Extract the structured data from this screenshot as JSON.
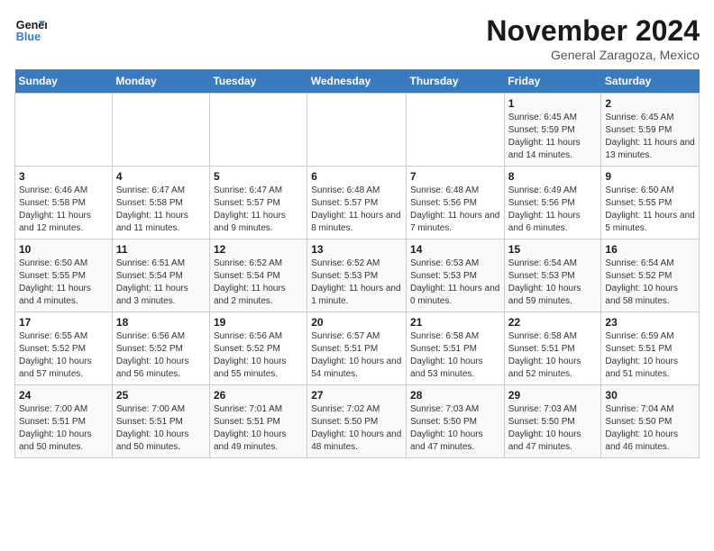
{
  "header": {
    "logo_line1": "General",
    "logo_line2": "Blue",
    "month": "November 2024",
    "location": "General Zaragoza, Mexico"
  },
  "weekdays": [
    "Sunday",
    "Monday",
    "Tuesday",
    "Wednesday",
    "Thursday",
    "Friday",
    "Saturday"
  ],
  "weeks": [
    [
      {
        "day": "",
        "info": ""
      },
      {
        "day": "",
        "info": ""
      },
      {
        "day": "",
        "info": ""
      },
      {
        "day": "",
        "info": ""
      },
      {
        "day": "",
        "info": ""
      },
      {
        "day": "1",
        "info": "Sunrise: 6:45 AM\nSunset: 5:59 PM\nDaylight: 11 hours and 14 minutes."
      },
      {
        "day": "2",
        "info": "Sunrise: 6:45 AM\nSunset: 5:59 PM\nDaylight: 11 hours and 13 minutes."
      }
    ],
    [
      {
        "day": "3",
        "info": "Sunrise: 6:46 AM\nSunset: 5:58 PM\nDaylight: 11 hours and 12 minutes."
      },
      {
        "day": "4",
        "info": "Sunrise: 6:47 AM\nSunset: 5:58 PM\nDaylight: 11 hours and 11 minutes."
      },
      {
        "day": "5",
        "info": "Sunrise: 6:47 AM\nSunset: 5:57 PM\nDaylight: 11 hours and 9 minutes."
      },
      {
        "day": "6",
        "info": "Sunrise: 6:48 AM\nSunset: 5:57 PM\nDaylight: 11 hours and 8 minutes."
      },
      {
        "day": "7",
        "info": "Sunrise: 6:48 AM\nSunset: 5:56 PM\nDaylight: 11 hours and 7 minutes."
      },
      {
        "day": "8",
        "info": "Sunrise: 6:49 AM\nSunset: 5:56 PM\nDaylight: 11 hours and 6 minutes."
      },
      {
        "day": "9",
        "info": "Sunrise: 6:50 AM\nSunset: 5:55 PM\nDaylight: 11 hours and 5 minutes."
      }
    ],
    [
      {
        "day": "10",
        "info": "Sunrise: 6:50 AM\nSunset: 5:55 PM\nDaylight: 11 hours and 4 minutes."
      },
      {
        "day": "11",
        "info": "Sunrise: 6:51 AM\nSunset: 5:54 PM\nDaylight: 11 hours and 3 minutes."
      },
      {
        "day": "12",
        "info": "Sunrise: 6:52 AM\nSunset: 5:54 PM\nDaylight: 11 hours and 2 minutes."
      },
      {
        "day": "13",
        "info": "Sunrise: 6:52 AM\nSunset: 5:53 PM\nDaylight: 11 hours and 1 minute."
      },
      {
        "day": "14",
        "info": "Sunrise: 6:53 AM\nSunset: 5:53 PM\nDaylight: 11 hours and 0 minutes."
      },
      {
        "day": "15",
        "info": "Sunrise: 6:54 AM\nSunset: 5:53 PM\nDaylight: 10 hours and 59 minutes."
      },
      {
        "day": "16",
        "info": "Sunrise: 6:54 AM\nSunset: 5:52 PM\nDaylight: 10 hours and 58 minutes."
      }
    ],
    [
      {
        "day": "17",
        "info": "Sunrise: 6:55 AM\nSunset: 5:52 PM\nDaylight: 10 hours and 57 minutes."
      },
      {
        "day": "18",
        "info": "Sunrise: 6:56 AM\nSunset: 5:52 PM\nDaylight: 10 hours and 56 minutes."
      },
      {
        "day": "19",
        "info": "Sunrise: 6:56 AM\nSunset: 5:52 PM\nDaylight: 10 hours and 55 minutes."
      },
      {
        "day": "20",
        "info": "Sunrise: 6:57 AM\nSunset: 5:51 PM\nDaylight: 10 hours and 54 minutes."
      },
      {
        "day": "21",
        "info": "Sunrise: 6:58 AM\nSunset: 5:51 PM\nDaylight: 10 hours and 53 minutes."
      },
      {
        "day": "22",
        "info": "Sunrise: 6:58 AM\nSunset: 5:51 PM\nDaylight: 10 hours and 52 minutes."
      },
      {
        "day": "23",
        "info": "Sunrise: 6:59 AM\nSunset: 5:51 PM\nDaylight: 10 hours and 51 minutes."
      }
    ],
    [
      {
        "day": "24",
        "info": "Sunrise: 7:00 AM\nSunset: 5:51 PM\nDaylight: 10 hours and 50 minutes."
      },
      {
        "day": "25",
        "info": "Sunrise: 7:00 AM\nSunset: 5:51 PM\nDaylight: 10 hours and 50 minutes."
      },
      {
        "day": "26",
        "info": "Sunrise: 7:01 AM\nSunset: 5:51 PM\nDaylight: 10 hours and 49 minutes."
      },
      {
        "day": "27",
        "info": "Sunrise: 7:02 AM\nSunset: 5:50 PM\nDaylight: 10 hours and 48 minutes."
      },
      {
        "day": "28",
        "info": "Sunrise: 7:03 AM\nSunset: 5:50 PM\nDaylight: 10 hours and 47 minutes."
      },
      {
        "day": "29",
        "info": "Sunrise: 7:03 AM\nSunset: 5:50 PM\nDaylight: 10 hours and 47 minutes."
      },
      {
        "day": "30",
        "info": "Sunrise: 7:04 AM\nSunset: 5:50 PM\nDaylight: 10 hours and 46 minutes."
      }
    ]
  ]
}
